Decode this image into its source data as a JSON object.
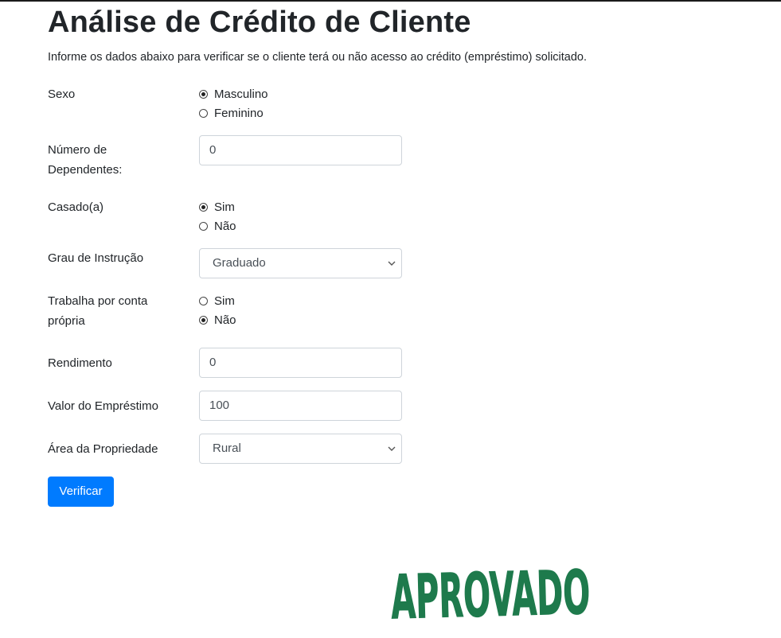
{
  "header": {
    "title": "Análise de Crédito de Cliente",
    "subtitle": "Informe os dados abaixo para verificar se o cliente terá ou não acesso ao crédito (empréstimo) solicitado."
  },
  "form": {
    "sexo": {
      "label": "Sexo",
      "options": [
        {
          "label": "Masculino",
          "checked": true
        },
        {
          "label": "Feminino",
          "checked": false
        }
      ]
    },
    "dependentes": {
      "label_line1": "Número de",
      "label_line2": "Dependentes:",
      "value": "0"
    },
    "casado": {
      "label": "Casado(a)",
      "options": [
        {
          "label": "Sim",
          "checked": true
        },
        {
          "label": "Não",
          "checked": false
        }
      ]
    },
    "instrucao": {
      "label": "Grau de Instrução",
      "selected": "Graduado"
    },
    "conta_propria": {
      "label_line1": "Trabalha por conta",
      "label_line2": "própria",
      "options": [
        {
          "label": "Sim",
          "checked": false
        },
        {
          "label": "Não",
          "checked": true
        }
      ]
    },
    "rendimento": {
      "label": "Rendimento",
      "value": "0"
    },
    "emprestimo": {
      "label": "Valor do Empréstimo",
      "value": "100"
    },
    "propriedade": {
      "label": "Área da Propriedade",
      "selected": "Rural"
    },
    "submit_label": "Verificar"
  },
  "result": {
    "stamp_text": "APROVADO",
    "stamp_color": "#1e7a4c"
  },
  "colors": {
    "primary": "#007bff",
    "text": "#212529",
    "border": "#ced4da"
  }
}
